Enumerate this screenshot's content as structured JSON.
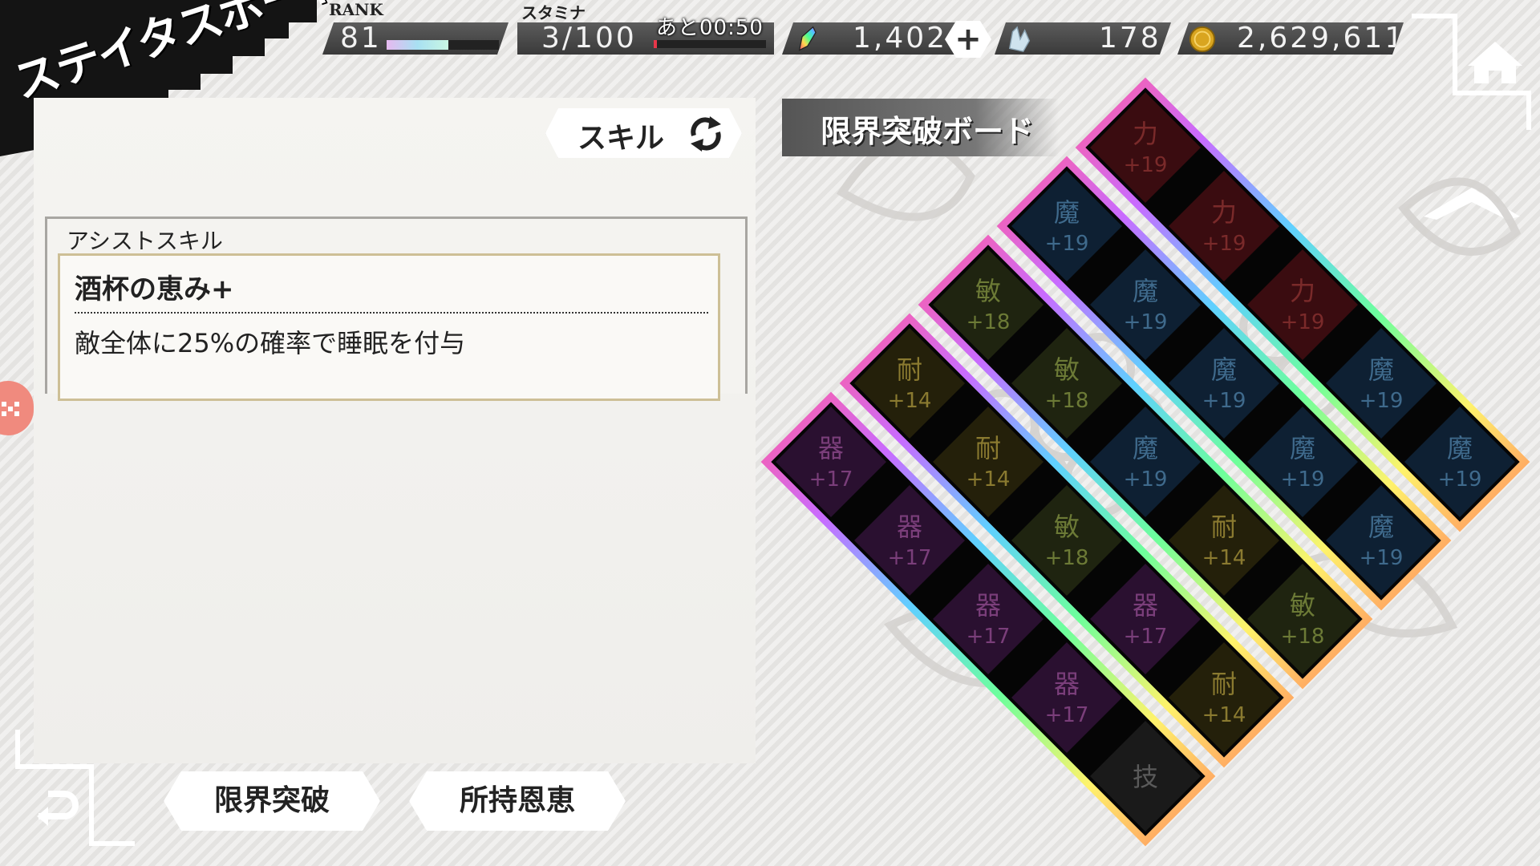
{
  "header": {
    "title": "ステイタスボード",
    "rank_label": "RANK",
    "rank": "81",
    "rank_progress": 0.55,
    "stamina_label": "スタミナ",
    "stamina": "3/100",
    "stamina_timer": "あと00:50",
    "stamina_progress": 0.03,
    "gems": "1,402",
    "add_label": "+",
    "crystals": "178",
    "coins": "2,629,611"
  },
  "left_panel": {
    "toggle_label": "スキル",
    "assist_header": "アシストスキル",
    "skill_name": "酒杯の恵み+",
    "skill_description": "敵全体に25%の確率で睡眠を付与"
  },
  "buttons": {
    "limit_break": "限界突破",
    "owned_blessings": "所持恩恵"
  },
  "board": {
    "title": "限界突破ボード",
    "cells": [
      {
        "col": 0,
        "row": 0,
        "stat": "力",
        "value": "+19",
        "type": "str"
      },
      {
        "col": 0,
        "row": 1,
        "stat": "力",
        "value": "+19",
        "type": "str"
      },
      {
        "col": 0,
        "row": 2,
        "stat": "力",
        "value": "+19",
        "type": "str"
      },
      {
        "col": 0,
        "row": 3,
        "stat": "魔",
        "value": "+19",
        "type": "mag"
      },
      {
        "col": 0,
        "row": 4,
        "stat": "魔",
        "value": "+19",
        "type": "mag"
      },
      {
        "col": 1,
        "row": 0,
        "stat": "魔",
        "value": "+19",
        "type": "mag"
      },
      {
        "col": 1,
        "row": 1,
        "stat": "魔",
        "value": "+19",
        "type": "mag"
      },
      {
        "col": 1,
        "row": 2,
        "stat": "魔",
        "value": "+19",
        "type": "mag"
      },
      {
        "col": 1,
        "row": 3,
        "stat": "魔",
        "value": "+19",
        "type": "mag"
      },
      {
        "col": 1,
        "row": 4,
        "stat": "魔",
        "value": "+19",
        "type": "mag"
      },
      {
        "col": 2,
        "row": 0,
        "stat": "敏",
        "value": "+18",
        "type": "agi"
      },
      {
        "col": 2,
        "row": 1,
        "stat": "敏",
        "value": "+18",
        "type": "agi"
      },
      {
        "col": 2,
        "row": 2,
        "stat": "魔",
        "value": "+19",
        "type": "mag"
      },
      {
        "col": 2,
        "row": 3,
        "stat": "耐",
        "value": "+14",
        "type": "end"
      },
      {
        "col": 2,
        "row": 4,
        "stat": "敏",
        "value": "+18",
        "type": "agi"
      },
      {
        "col": 3,
        "row": 0,
        "stat": "耐",
        "value": "+14",
        "type": "end"
      },
      {
        "col": 3,
        "row": 1,
        "stat": "耐",
        "value": "+14",
        "type": "end"
      },
      {
        "col": 3,
        "row": 2,
        "stat": "敏",
        "value": "+18",
        "type": "agi"
      },
      {
        "col": 3,
        "row": 3,
        "stat": "器",
        "value": "+17",
        "type": "dex"
      },
      {
        "col": 3,
        "row": 4,
        "stat": "耐",
        "value": "+14",
        "type": "end"
      },
      {
        "col": 4,
        "row": 0,
        "stat": "器",
        "value": "+17",
        "type": "dex"
      },
      {
        "col": 4,
        "row": 1,
        "stat": "器",
        "value": "+17",
        "type": "dex"
      },
      {
        "col": 4,
        "row": 2,
        "stat": "器",
        "value": "+17",
        "type": "dex"
      },
      {
        "col": 4,
        "row": 3,
        "stat": "器",
        "value": "+17",
        "type": "dex"
      },
      {
        "col": 4,
        "row": 4,
        "stat": "技",
        "value": "",
        "type": "skill"
      }
    ]
  },
  "colors": {
    "str": "#3a0c10",
    "mag": "#0e2033",
    "agi": "#1f2410",
    "end": "#24200a",
    "dex": "#2a1030",
    "skill": "#1a1a1a",
    "str_text": "#7a2a2a",
    "mag_text": "#3f6a8c",
    "agi_text": "#6c7a36",
    "end_text": "#8a7a30",
    "dex_text": "#7a3e7a",
    "skill_text": "#5a5a5a"
  }
}
